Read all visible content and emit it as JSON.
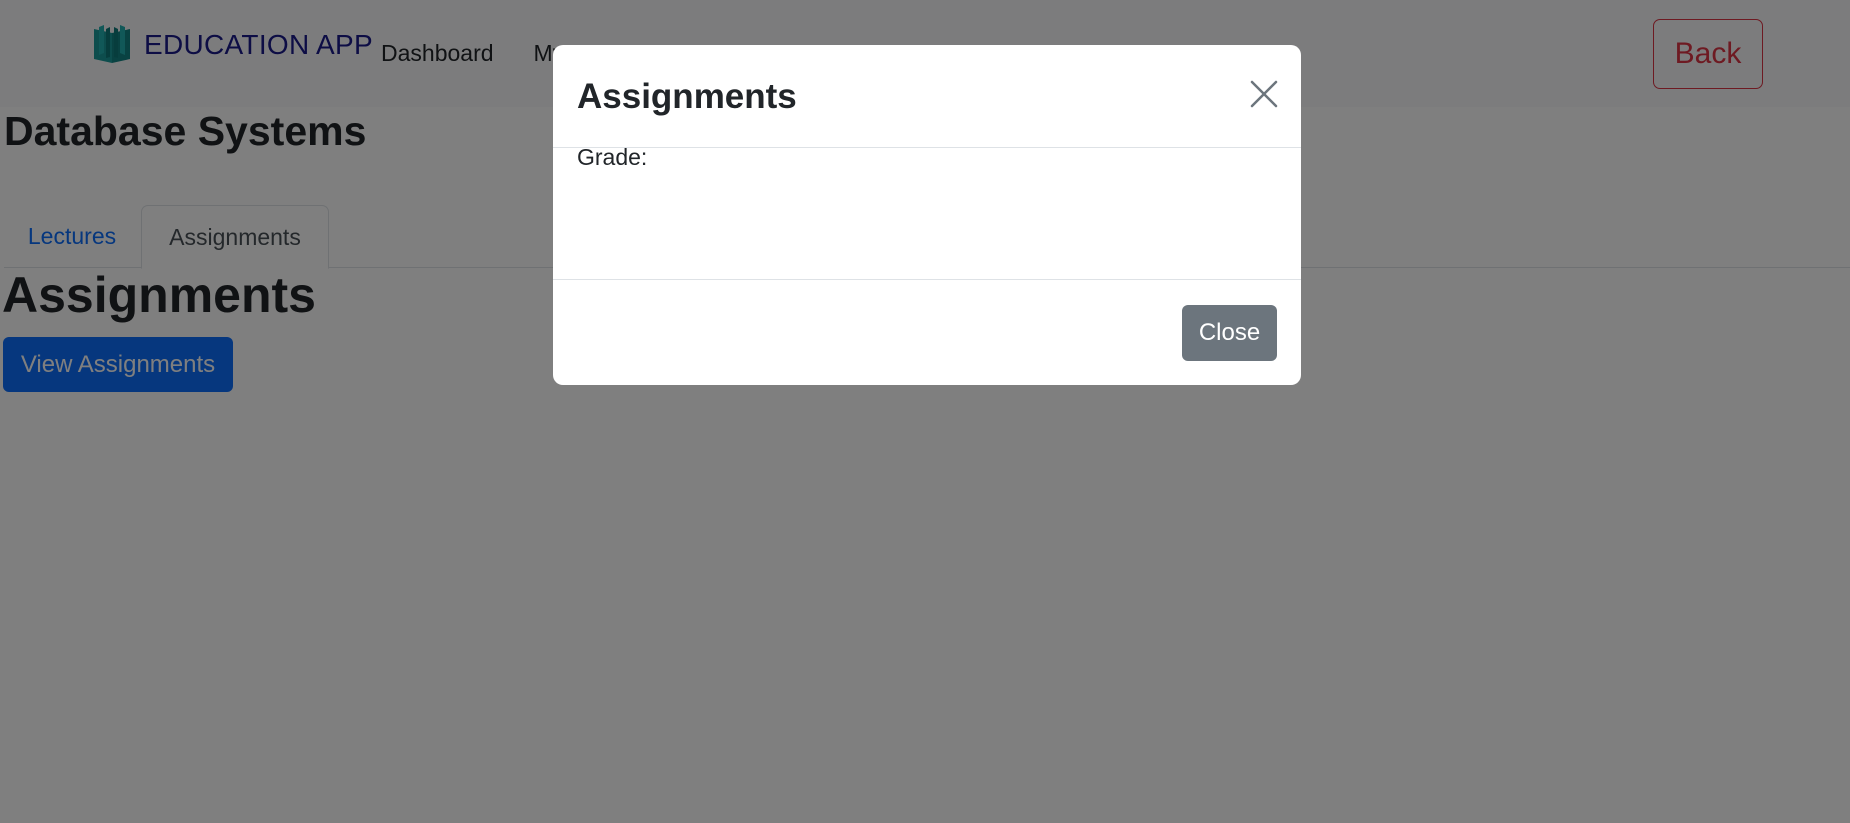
{
  "navbar": {
    "brand_text": "EDUCATION APP",
    "brand_icon": "open-book-icon",
    "links": [
      "Dashboard",
      "My Courses"
    ],
    "back_label": "Back"
  },
  "course": {
    "title": "Database Systems"
  },
  "tabs": [
    {
      "label": "Lectures",
      "active": false
    },
    {
      "label": "Assignments",
      "active": true
    }
  ],
  "section": {
    "title": "Assignments",
    "view_button": "View Assignments"
  },
  "modal": {
    "title": "Assignments",
    "grade_label": "Grade:",
    "close_label": "Close",
    "close_icon": "close-icon"
  },
  "colors": {
    "primary": "#0d6efd",
    "danger": "#dc3545",
    "secondary": "#6c757d",
    "brand_text": "#1a1a8a",
    "logo": "#1a9a9a"
  }
}
